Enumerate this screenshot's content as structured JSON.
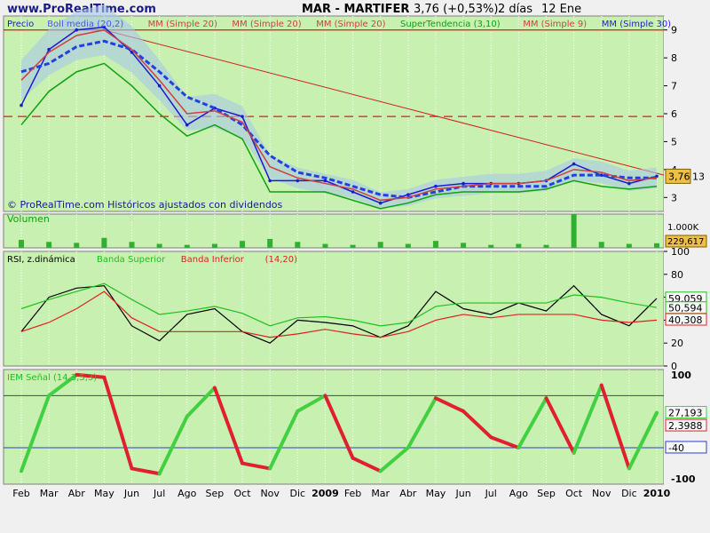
{
  "header": {
    "site": "www.ProRealTime.com",
    "instrument": "MAR - MARTIFER",
    "quote": "3,76 (+0,53%)",
    "period": "2 días",
    "date": "12 Ene"
  },
  "panels": {
    "price": {
      "legend": [
        {
          "text": "Precio",
          "color": "#1a1ad0"
        },
        {
          "text": "Boll media (20,2)",
          "color": "#5050ff"
        },
        {
          "text": "MM (Simple 20)",
          "color": "#d04040"
        },
        {
          "text": "MM (Simple 20)",
          "color": "#d04040"
        },
        {
          "text": "MM (Simple 20)",
          "color": "#d04040"
        },
        {
          "text": "SuperTendencia (3,10)",
          "color": "#10a010"
        },
        {
          "text": "MM (Simple 9)",
          "color": "#d04040"
        },
        {
          "text": "MM (Simple 30)",
          "color": "#2020e0"
        }
      ],
      "copyright": "© ProRealTime.com Históricos ajustados con dividendos",
      "y_ticks": [
        "9",
        "8",
        "7",
        "6",
        "5",
        "4",
        "3"
      ],
      "last_price": "3,76",
      "side_value": "13"
    },
    "volume": {
      "label": "Volumen",
      "y_ticks": [
        "1.000K"
      ],
      "last_value": "229,617"
    },
    "rsi": {
      "legend": [
        {
          "text": "RSI, z.dinámica",
          "color": "#000000"
        },
        {
          "text": "Banda Superior",
          "color": "#20c020"
        },
        {
          "text": "Banda Inferior",
          "color": "#e02020"
        },
        {
          "text": "(14,20)",
          "color": "#e02020"
        }
      ],
      "y_ticks": [
        "100",
        "80",
        "60",
        "40",
        "20",
        "0"
      ],
      "values": [
        "59,059",
        "50,594",
        "40,308"
      ]
    },
    "iem": {
      "legend": [
        {
          "text": "IEM Señal (14,3,5,3)",
          "color": "#20c020"
        }
      ],
      "y_ticks": [
        "100",
        "-100"
      ],
      "values": [
        "27,193",
        "2,3988",
        "-40"
      ]
    }
  },
  "x_axis": {
    "labels": [
      "Feb",
      "Mar",
      "Abr",
      "May",
      "Jun",
      "Jul",
      "Ago",
      "Sep",
      "Oct",
      "Nov",
      "Dic",
      "2009",
      "Feb",
      "Mar",
      "Abr",
      "May",
      "Jun",
      "Jul",
      "Ago",
      "Sep",
      "Oct",
      "Nov",
      "Dic",
      "2010"
    ]
  },
  "chart_data": [
    {
      "type": "line",
      "panel": "price",
      "x": [
        "Feb",
        "Mar",
        "Abr",
        "May",
        "Jun",
        "Jul",
        "Ago",
        "Sep",
        "Oct",
        "Nov",
        "Dic",
        "2009",
        "Feb",
        "Mar",
        "Abr",
        "May",
        "Jun",
        "Jul",
        "Ago",
        "Sep",
        "Oct",
        "Nov",
        "Dic",
        "2010"
      ],
      "ylim": [
        2.5,
        9.5
      ],
      "series": [
        {
          "name": "Precio",
          "values": [
            6.3,
            8.3,
            9.0,
            9.1,
            8.2,
            7.0,
            5.6,
            6.2,
            5.9,
            3.6,
            3.6,
            3.6,
            3.2,
            2.8,
            3.1,
            3.4,
            3.5,
            3.5,
            3.5,
            3.6,
            4.2,
            3.8,
            3.5,
            3.76
          ]
        },
        {
          "name": "MM (Simple 30)",
          "values": [
            7.5,
            7.8,
            8.4,
            8.6,
            8.3,
            7.5,
            6.6,
            6.2,
            5.6,
            4.5,
            3.9,
            3.7,
            3.4,
            3.1,
            3.0,
            3.2,
            3.4,
            3.4,
            3.4,
            3.4,
            3.8,
            3.8,
            3.7,
            3.7
          ]
        },
        {
          "name": "MM (Simple 20)",
          "values": [
            7.2,
            8.2,
            8.8,
            9.0,
            8.3,
            7.2,
            6.0,
            6.1,
            5.7,
            4.1,
            3.7,
            3.5,
            3.3,
            2.9,
            3.0,
            3.3,
            3.4,
            3.5,
            3.5,
            3.6,
            4.0,
            3.9,
            3.6,
            3.7
          ]
        },
        {
          "name": "SuperTendencia (3,10)",
          "values": [
            5.6,
            6.8,
            7.5,
            7.8,
            7.0,
            6.0,
            5.2,
            5.6,
            5.1,
            3.2,
            3.2,
            3.2,
            2.9,
            2.6,
            2.8,
            3.1,
            3.2,
            3.2,
            3.2,
            3.3,
            3.6,
            3.4,
            3.3,
            3.4
          ]
        }
      ],
      "horizontal_levels": [
        9.0,
        5.9
      ]
    },
    {
      "type": "bar",
      "panel": "volume",
      "categories": [
        "Feb",
        "Mar",
        "Abr",
        "May",
        "Jun",
        "Jul",
        "Ago",
        "Sep",
        "Oct",
        "Nov",
        "Dic",
        "2009",
        "Feb",
        "Mar",
        "Abr",
        "May",
        "Jun",
        "Jul",
        "Ago",
        "Sep",
        "Oct",
        "Nov",
        "Dic",
        "2010"
      ],
      "values": [
        400,
        300,
        250,
        500,
        300,
        200,
        150,
        200,
        350,
        450,
        300,
        200,
        150,
        300,
        200,
        350,
        250,
        150,
        200,
        150,
        1700,
        300,
        200,
        229.617
      ],
      "ylim": [
        0,
        1700
      ]
    },
    {
      "type": "line",
      "panel": "rsi",
      "x": [
        "Feb",
        "Mar",
        "Abr",
        "May",
        "Jun",
        "Jul",
        "Ago",
        "Sep",
        "Oct",
        "Nov",
        "Dic",
        "2009",
        "Feb",
        "Mar",
        "Abr",
        "May",
        "Jun",
        "Jul",
        "Ago",
        "Sep",
        "Oct",
        "Nov",
        "Dic",
        "2010"
      ],
      "ylim": [
        0,
        100
      ],
      "series": [
        {
          "name": "RSI, z.dinámica",
          "values": [
            30,
            60,
            68,
            70,
            35,
            22,
            45,
            50,
            30,
            20,
            40,
            38,
            35,
            25,
            35,
            65,
            50,
            45,
            55,
            48,
            70,
            45,
            35,
            59
          ]
        },
        {
          "name": "Banda Superior",
          "values": [
            50,
            58,
            65,
            72,
            58,
            45,
            48,
            52,
            46,
            35,
            42,
            43,
            40,
            35,
            38,
            52,
            55,
            55,
            55,
            55,
            62,
            60,
            55,
            51
          ]
        },
        {
          "name": "Banda Inferior",
          "values": [
            30,
            38,
            50,
            65,
            42,
            30,
            30,
            30,
            30,
            25,
            28,
            32,
            28,
            25,
            30,
            40,
            45,
            42,
            45,
            45,
            45,
            40,
            38,
            40
          ]
        }
      ]
    },
    {
      "type": "line",
      "panel": "iem",
      "x": [
        "Feb",
        "Mar",
        "Abr",
        "May",
        "Jun",
        "Jul",
        "Ago",
        "Sep",
        "Oct",
        "Nov",
        "Dic",
        "2009",
        "Feb",
        "Mar",
        "Abr",
        "May",
        "Jun",
        "Jul",
        "Ago",
        "Sep",
        "Oct",
        "Nov",
        "Dic",
        "2010"
      ],
      "ylim": [
        -110,
        110
      ],
      "series": [
        {
          "name": "IEM Señal (14,3,5,3)",
          "values": [
            -85,
            60,
            100,
            95,
            -80,
            -90,
            20,
            75,
            -70,
            -80,
            30,
            60,
            -60,
            -85,
            -40,
            55,
            30,
            -20,
            -40,
            55,
            -50,
            80,
            -80,
            27.19
          ]
        }
      ],
      "horizontal_levels": [
        60,
        -40
      ]
    }
  ]
}
